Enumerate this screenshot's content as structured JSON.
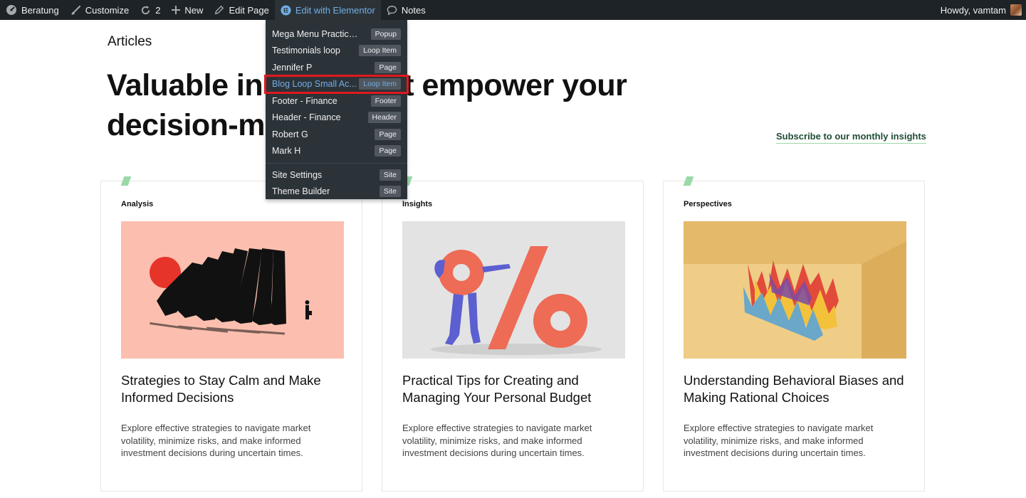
{
  "adminbar": {
    "site": "Beratung",
    "customize": "Customize",
    "updates": "2",
    "new": "New",
    "edit_page": "Edit Page",
    "elementor": "Edit with Elementor",
    "notes": "Notes",
    "howdy": "Howdy, vamtam",
    "icons": [
      "dashboard-icon",
      "brush-icon",
      "refresh-icon",
      "plus-icon",
      "pencil-icon",
      "elementor-icon",
      "comment-icon"
    ]
  },
  "dropdown": {
    "items": [
      {
        "label": "Mega Menu Practice A...",
        "badge": "Popup"
      },
      {
        "label": "Testimonials loop",
        "badge": "Loop Item"
      },
      {
        "label": "Jennifer P",
        "badge": "Page"
      },
      {
        "label": "Blog Loop Small Ac...",
        "badge": "Loop Item"
      },
      {
        "label": "Footer - Finance",
        "badge": "Footer"
      },
      {
        "label": "Header - Finance",
        "badge": "Header"
      },
      {
        "label": "Robert G",
        "badge": "Page"
      },
      {
        "label": "Mark H",
        "badge": "Page"
      }
    ],
    "footer_items": [
      {
        "label": "Site Settings",
        "badge": "Site"
      },
      {
        "label": "Theme Builder",
        "badge": "Site"
      }
    ],
    "highlight_color": "#e0181e"
  },
  "page": {
    "eyebrow": "Articles",
    "headline": "Valuable insights that empower your decision-making",
    "subscribe": "Subscribe to our monthly insights"
  },
  "cards": [
    {
      "category": "Analysis",
      "title": "Strategies to Stay Calm and Make Informed Decisions",
      "excerpt": "Explore effective strategies to navigate market volatility, minimize risks, and make informed investment decisions during uncertain times."
    },
    {
      "category": "Insights",
      "title": "Practical Tips for Creating and Managing Your Personal Budget",
      "excerpt": "Explore effective strategies to navigate market volatility, minimize risks, and make informed investment decisions during uncertain times."
    },
    {
      "category": "Perspectives",
      "title": "Understanding Behavioral Biases and Making Rational Choices",
      "excerpt": "Explore effective strategies to navigate market volatility, minimize risks, and make informed investment decisions during uncertain times."
    }
  ],
  "colors": {
    "adminbar": "#1d2327",
    "accent_green": "#9ad9a8",
    "link_blue": "#72aee6"
  }
}
